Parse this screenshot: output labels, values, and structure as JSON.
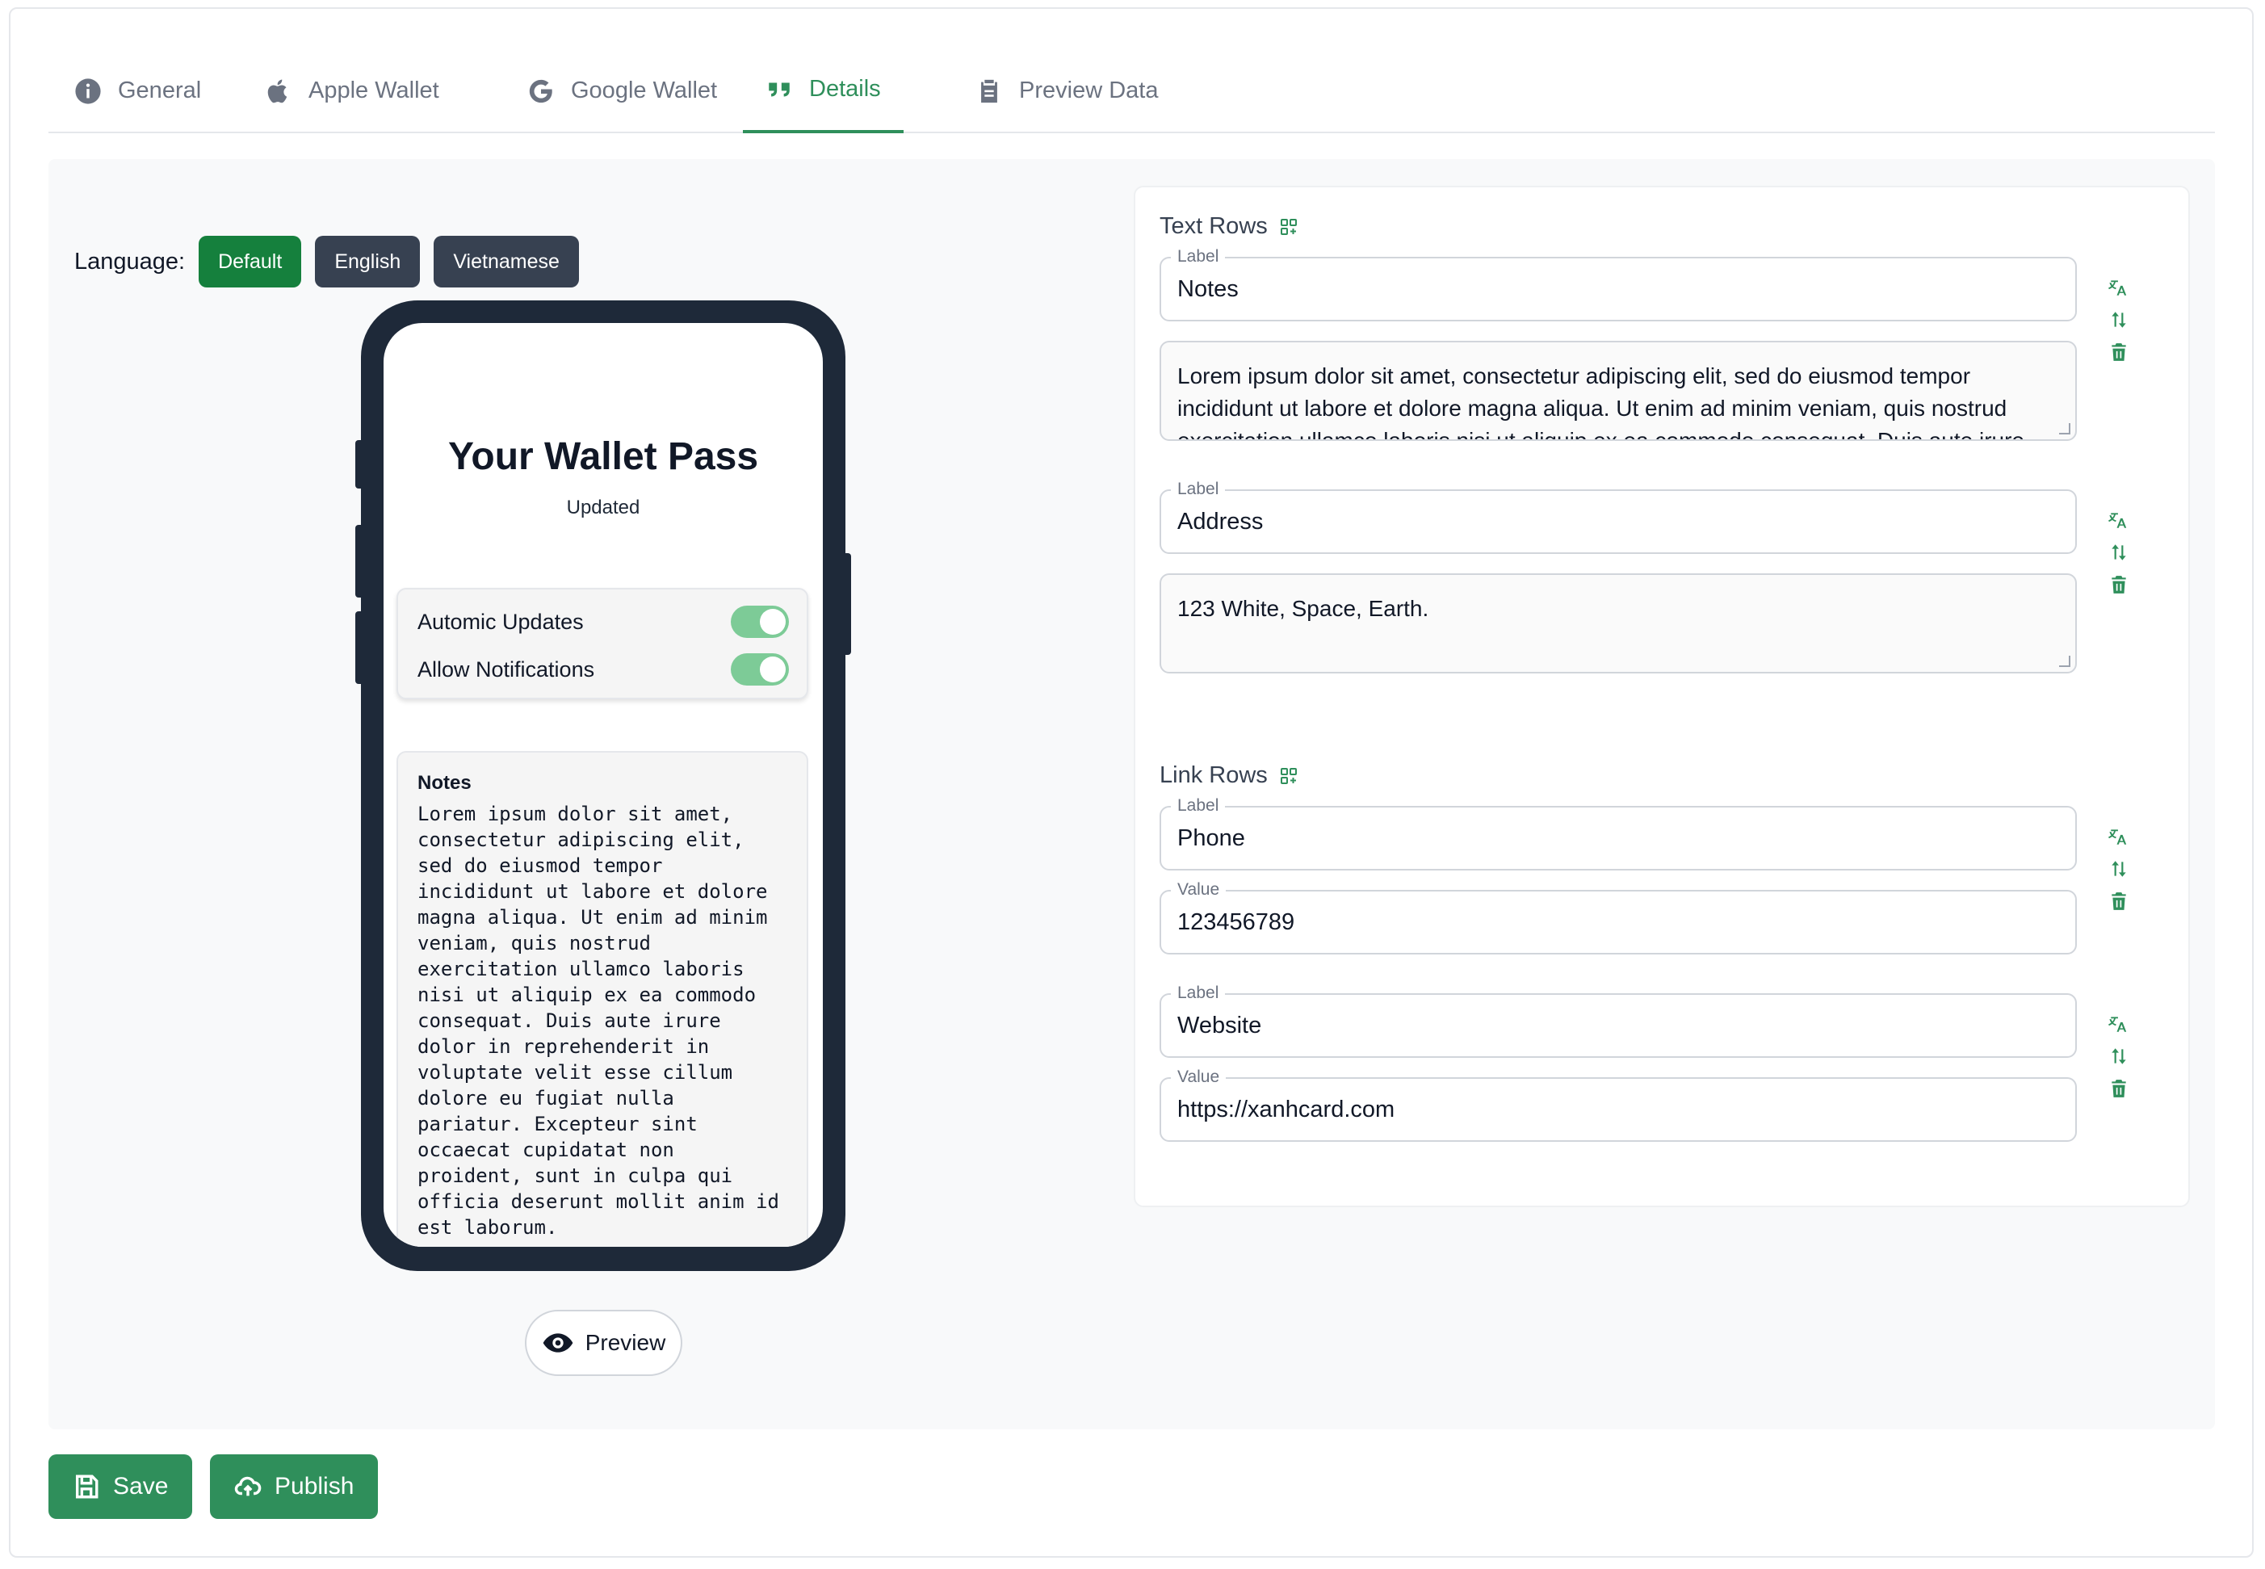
{
  "tabs": [
    {
      "label": "General",
      "icon": "info-icon"
    },
    {
      "label": "Apple Wallet",
      "icon": "apple-icon"
    },
    {
      "label": "Google Wallet",
      "icon": "google-icon"
    },
    {
      "label": "Details",
      "icon": "quote-icon",
      "active": true
    },
    {
      "label": "Preview Data",
      "icon": "clipboard-icon"
    }
  ],
  "language": {
    "label": "Language:",
    "options": [
      "Default",
      "English",
      "Vietnamese"
    ],
    "selected": "Default"
  },
  "phone": {
    "title": "Your Wallet Pass",
    "subtitle": "Updated",
    "toggles": [
      {
        "label": "Automic Updates",
        "on": true
      },
      {
        "label": "Allow Notifications",
        "on": true
      }
    ],
    "notes_label": "Notes",
    "notes_body": "Lorem ipsum dolor sit amet,\nconsectetur adipiscing elit,\nsed do eiusmod tempor\nincididunt ut labore et dolore\nmagna aliqua. Ut enim ad minim\nveniam, quis nostrud\nexercitation ullamco laboris\nnisi ut aliquip ex ea commodo\nconsequat. Duis aute irure\ndolor in reprehenderit in\nvoluptate velit esse cillum\ndolore eu fugiat nulla\npariatur. Excepteur sint\noccaecat cupidatat non\nproident, sunt in culpa qui\nofficia deserunt mollit anim id\nest laborum."
  },
  "preview_button": "Preview",
  "text_rows": {
    "title": "Text Rows",
    "rows": [
      {
        "label_caption": "Label",
        "label": "Notes",
        "value": "Lorem ipsum dolor sit amet, consectetur adipiscing elit, sed do eiusmod tempor incididunt ut labore et dolore magna aliqua. Ut enim ad minim veniam, quis nostrud exercitation ullamco laboris nisi ut aliquip ex ea commodo consequat. Duis aute irure"
      },
      {
        "label_caption": "Label",
        "label": "Address",
        "value": "123 White, Space, Earth."
      }
    ]
  },
  "link_rows": {
    "title": "Link Rows",
    "rows": [
      {
        "label_caption": "Label",
        "label": "Phone",
        "value_caption": "Value",
        "value": "123456789"
      },
      {
        "label_caption": "Label",
        "label": "Website",
        "value_caption": "Value",
        "value": "https://xanhcard.com"
      }
    ]
  },
  "actions": {
    "save": "Save",
    "publish": "Publish"
  },
  "colors": {
    "accent": "#2f8f5b",
    "default_lang": "#15803d",
    "lang_dark": "#374151",
    "phone_frame": "#1e2939",
    "toggle_on": "#7dcb97"
  }
}
